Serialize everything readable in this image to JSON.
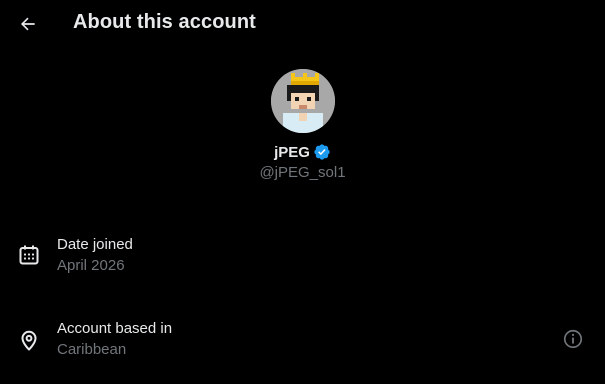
{
  "header": {
    "title": "About this account"
  },
  "profile": {
    "display_name": "jPEG",
    "handle": "@jPEG_sol1",
    "verified": true
  },
  "details": {
    "date_joined": {
      "label": "Date joined",
      "value": "April 2026"
    },
    "based_in": {
      "label": "Account based in",
      "value": "Caribbean"
    }
  },
  "colors": {
    "background": "#000000",
    "primary_text": "#e7e9ea",
    "secondary_text": "#71767b",
    "verified_badge": "#1d9bf0"
  },
  "icons": [
    "back-arrow-icon",
    "verified-badge-icon",
    "calendar-icon",
    "location-pin-icon",
    "info-icon"
  ]
}
